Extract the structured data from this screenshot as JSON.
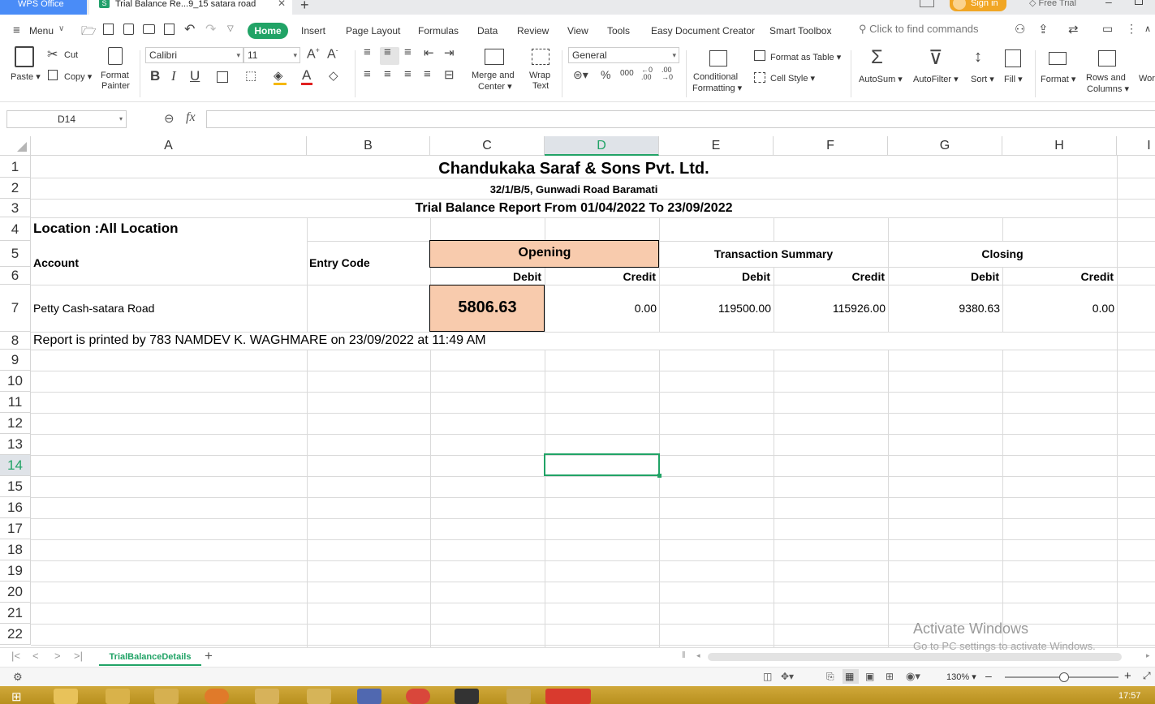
{
  "titlebar": {
    "app_tab": "WPS Office",
    "doc_tab": "Trial Balance Re...9_15 satara road",
    "sign_in": "Sign in",
    "free_trial": "Free Trial"
  },
  "menubar": {
    "menu_label": "Menu",
    "tabs": [
      "Home",
      "Insert",
      "Page Layout",
      "Formulas",
      "Data",
      "Review",
      "View",
      "Tools",
      "Easy Document Creator",
      "Smart Toolbox"
    ],
    "search_placeholder": "Click to find commands"
  },
  "ribbon": {
    "paste": "Paste",
    "cut": "Cut",
    "copy": "Copy",
    "format_painter_1": "Format",
    "format_painter_2": "Painter",
    "font_name": "Calibri",
    "font_size": "11",
    "merge_1": "Merge and",
    "merge_2": "Center",
    "wrap_1": "Wrap",
    "wrap_2": "Text",
    "number_format": "General",
    "cond_1": "Conditional",
    "cond_2": "Formatting",
    "format_as_table": "Format as Table",
    "cell_style": "Cell Style",
    "autosum": "AutoSum",
    "autofilter": "AutoFilter",
    "sort": "Sort",
    "fill": "Fill",
    "format": "Format",
    "rows_cols_1": "Rows and",
    "rows_cols_2": "Columns",
    "wor": "Wor"
  },
  "formula_bar": {
    "name_box": "D14",
    "fx": "fx",
    "content": ""
  },
  "columns": [
    "A",
    "B",
    "C",
    "D",
    "E",
    "F",
    "G",
    "H",
    "I"
  ],
  "active_column": "D",
  "rows": [
    "1",
    "2",
    "3",
    "4",
    "5",
    "6",
    "7",
    "8",
    "9",
    "10",
    "11",
    "12",
    "13",
    "14",
    "15",
    "16",
    "17",
    "18",
    "19",
    "20",
    "21",
    "22"
  ],
  "active_row": "14",
  "sheet": {
    "company": "Chandukaka Saraf & Sons Pvt. Ltd.",
    "address": "32/1/B/5, Gunwadi Road Baramati",
    "report_title": "Trial Balance Report From 01/04/2022 To 23/09/2022",
    "location": "Location :All Location",
    "account_header": "Account",
    "entry_code_header": "Entry Code",
    "opening_header": "Opening",
    "transaction_header": "Transaction Summary",
    "closing_header": "Closing",
    "debit": "Debit",
    "credit": "Credit",
    "account_name": "Petty Cash-satara Road",
    "opening_debit": "5806.63",
    "opening_credit": "0.00",
    "trans_debit": "119500.00",
    "trans_credit": "115926.00",
    "closing_debit": "9380.63",
    "closing_credit": "0.00",
    "footer": "Report is printed by 783 NAMDEV K. WAGHMARE on 23/09/2022 at 11:49 AM",
    "highlight_color": "#f8cbad"
  },
  "sheet_tabs": {
    "active": "TrialBalanceDetails",
    "add": "+"
  },
  "statusbar": {
    "zoom": "130%"
  },
  "watermark": {
    "line1": "Activate Windows",
    "line2": "Go to PC settings to activate Windows."
  },
  "taskbar": {
    "time": "17:57"
  }
}
